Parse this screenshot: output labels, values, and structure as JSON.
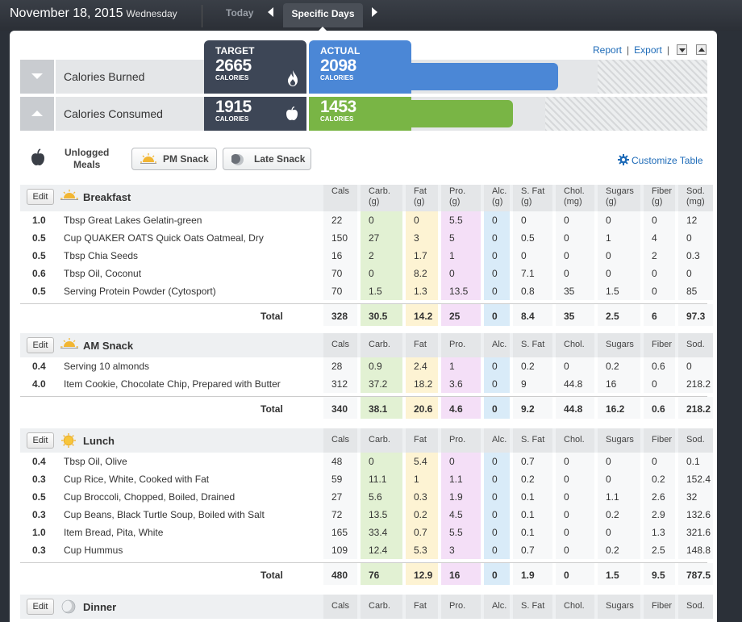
{
  "topbar": {
    "date": "November 18, 2015",
    "weekday": "Wednesday",
    "today_label": "Today",
    "specific_days_label": "Specific Days"
  },
  "links": {
    "report": "Report",
    "export": "Export"
  },
  "summary": {
    "burned": {
      "label": "Calories Burned",
      "target_header": "TARGET",
      "target_value": "2665",
      "target_unit": "CALORIES",
      "actual_header": "ACTUAL",
      "actual_value": "2098",
      "actual_unit": "CALORIES",
      "fill_fraction": 0.79
    },
    "consumed": {
      "label": "Calories Consumed",
      "target_value": "1915",
      "target_unit": "CALORIES",
      "actual_value": "1453",
      "actual_unit": "CALORIES",
      "fill_fraction": 0.76
    }
  },
  "unlogged": {
    "label_line1": "Unlogged",
    "label_line2": "Meals",
    "buttons": [
      "PM Snack",
      "Late Snack"
    ]
  },
  "customize_label": "Customize Table",
  "edit_label": "Edit",
  "total_label": "Total",
  "colors": {
    "blue": "#4b87d6",
    "green": "#79b545",
    "target": "#3d4656",
    "link": "#1e6bb8"
  },
  "columns_with_units": [
    [
      "Cals",
      ""
    ],
    [
      "Carb.",
      "(g)"
    ],
    [
      "Fat",
      "(g)"
    ],
    [
      "Pro.",
      "(g)"
    ],
    [
      "Alc.",
      "(g)"
    ],
    [
      "S. Fat",
      "(g)"
    ],
    [
      "Chol.",
      "(mg)"
    ],
    [
      "Sugars",
      "(g)"
    ],
    [
      "Fiber",
      "(g)"
    ],
    [
      "Sod.",
      "(mg)"
    ]
  ],
  "columns_plain": [
    "Cals",
    "Carb.",
    "Fat",
    "Pro.",
    "Alc.",
    "S. Fat",
    "Chol.",
    "Sugars",
    "Fiber",
    "Sod."
  ],
  "meals": [
    {
      "name": "Breakfast",
      "icon": "sunrise-icon",
      "units": true,
      "rows": [
        [
          "1.0",
          "Tbsp Great Lakes Gelatin-green",
          "22",
          "0",
          "0",
          "5.5",
          "0",
          "0",
          "0",
          "0",
          "0",
          "12"
        ],
        [
          "0.5",
          "Cup QUAKER OATS Quick Oats Oatmeal, Dry",
          "150",
          "27",
          "3",
          "5",
          "0",
          "0.5",
          "0",
          "1",
          "4",
          "0"
        ],
        [
          "0.5",
          "Tbsp Chia Seeds",
          "16",
          "2",
          "1.7",
          "1",
          "0",
          "0",
          "0",
          "0",
          "2",
          "0.3"
        ],
        [
          "0.6",
          "Tbsp Oil, Coconut",
          "70",
          "0",
          "8.2",
          "0",
          "0",
          "7.1",
          "0",
          "0",
          "0",
          "0"
        ],
        [
          "0.5",
          "Serving Protein Powder (Cytosport)",
          "70",
          "1.5",
          "1.3",
          "13.5",
          "0",
          "0.8",
          "35",
          "1.5",
          "0",
          "85"
        ]
      ],
      "total": [
        "328",
        "30.5",
        "14.2",
        "25",
        "0",
        "8.4",
        "35",
        "2.5",
        "6",
        "97.3"
      ]
    },
    {
      "name": "AM Snack",
      "icon": "morning-sun-icon",
      "units": false,
      "rows": [
        [
          "0.4",
          "Serving 10 almonds",
          "28",
          "0.9",
          "2.4",
          "1",
          "0",
          "0.2",
          "0",
          "0.2",
          "0.6",
          "0"
        ],
        [
          "4.0",
          "Item Cookie, Chocolate Chip, Prepared with Butter",
          "312",
          "37.2",
          "18.2",
          "3.6",
          "0",
          "9",
          "44.8",
          "16",
          "0",
          "218.2"
        ]
      ],
      "total": [
        "340",
        "38.1",
        "20.6",
        "4.6",
        "0",
        "9.2",
        "44.8",
        "16.2",
        "0.6",
        "218.2"
      ]
    },
    {
      "name": "Lunch",
      "icon": "sun-icon",
      "units": false,
      "rows": [
        [
          "0.4",
          "Tbsp Oil, Olive",
          "48",
          "0",
          "5.4",
          "0",
          "0",
          "0.7",
          "0",
          "0",
          "0",
          "0.1"
        ],
        [
          "0.3",
          "Cup Rice, White, Cooked with Fat",
          "59",
          "11.1",
          "1",
          "1.1",
          "0",
          "0.2",
          "0",
          "0",
          "0.2",
          "152.4"
        ],
        [
          "0.5",
          "Cup Broccoli, Chopped, Boiled, Drained",
          "27",
          "5.6",
          "0.3",
          "1.9",
          "0",
          "0.1",
          "0",
          "1.1",
          "2.6",
          "32"
        ],
        [
          "0.3",
          "Cup Beans, Black Turtle Soup, Boiled with Salt",
          "72",
          "13.5",
          "0.2",
          "4.5",
          "0",
          "0.1",
          "0",
          "0.2",
          "2.9",
          "132.6"
        ],
        [
          "1.0",
          "Item Bread, Pita, White",
          "165",
          "33.4",
          "0.7",
          "5.5",
          "0",
          "0.1",
          "0",
          "0",
          "1.3",
          "321.6"
        ],
        [
          "0.3",
          "Cup Hummus",
          "109",
          "12.4",
          "5.3",
          "3",
          "0",
          "0.7",
          "0",
          "0.2",
          "2.5",
          "148.8"
        ]
      ],
      "total": [
        "480",
        "76",
        "12.9",
        "16",
        "0",
        "1.9",
        "0",
        "1.5",
        "9.5",
        "787.5"
      ]
    },
    {
      "name": "Dinner",
      "icon": "moon-icon",
      "units": false,
      "rows": [],
      "total": null
    }
  ]
}
